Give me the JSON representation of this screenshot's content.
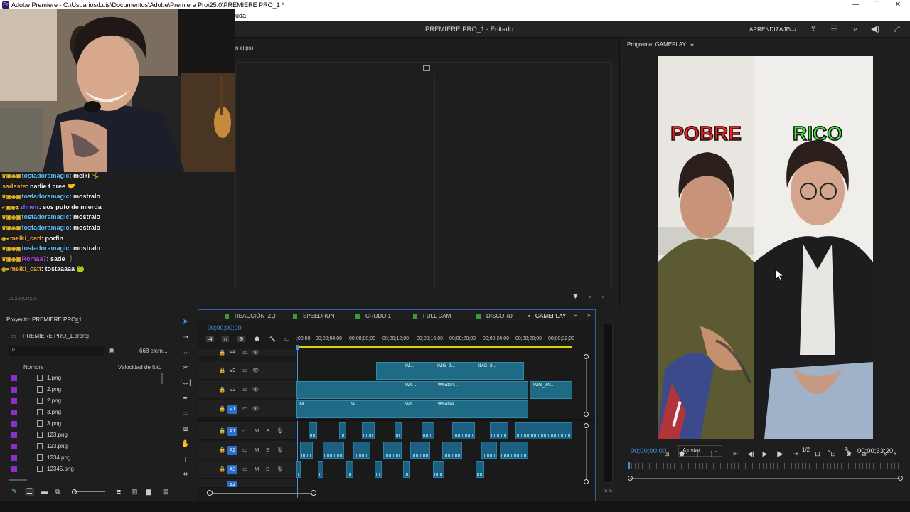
{
  "titlebar": {
    "logo": "Pr",
    "title": "Adobe Premiere - C:\\Usuarios\\Luis\\Documentos\\Adobe\\Premiere Pro\\25.0\\PREMIERE PRO_1 *",
    "minimize": "—",
    "restore": "❐",
    "close": "✕"
  },
  "menubar": {
    "partial_item": "uda"
  },
  "header": {
    "project_title": "PREMIERE PRO_1 - Editado",
    "learn": "APRENDIZAJE"
  },
  "source": {
    "partial_tab": "n clips)",
    "timecode": "00;00;00;00"
  },
  "chat": [
    {
      "badges": "♛▣◉▣",
      "user": "tostadoramagic",
      "user_color": "#5fc0ff",
      "text": "melki 🤸"
    },
    {
      "badges": "",
      "user": "sadeste",
      "user_color": "#e8a33b",
      "text": "nadie t cree 🤝"
    },
    {
      "badges": "♛▣◉▣",
      "user": "tostadoramagic",
      "user_color": "#5fc0ff",
      "text": "mostralo"
    },
    {
      "badges": "✔▣◉⧗",
      "user": "zhheir",
      "user_color": "#8a5cff",
      "text": "sos puto de mierda"
    },
    {
      "badges": "♛▣◉▣",
      "user": "tostadoramagic",
      "user_color": "#5fc0ff",
      "text": "mostralo"
    },
    {
      "badges": "♛▣◉▣",
      "user": "tostadoramagic",
      "user_color": "#5fc0ff",
      "text": "mostralo"
    },
    {
      "badges": "◉♥",
      "user": "melki_catt",
      "user_color": "#e8a33b",
      "text": "porfin"
    },
    {
      "badges": "♛▣◉▣",
      "user": "tostadoramagic",
      "user_color": "#5fc0ff",
      "text": "mostralo"
    },
    {
      "badges": "♛▣◉▣",
      "user": "Romaa7",
      "user_color": "#b44ad8",
      "text": "sade 🕴"
    },
    {
      "badges": "◉♥",
      "user": "melki_catt",
      "user_color": "#e8a33b",
      "text": "tostaaaaa 🐸"
    }
  ],
  "program": {
    "title": "Programa: GAMEPLAY",
    "left_label": "POBRE",
    "left_color": "#ff1e1e",
    "right_label": "RICO",
    "right_color": "#3ee63e",
    "timecode": "00;00;00;00",
    "fit": "Ajustar",
    "resolution": "1/2",
    "duration": "00;00;33;20"
  },
  "project": {
    "title": "Proyecto: PREMIERE PRO_1",
    "file": "PREMIERE PRO_1.prproj",
    "count": "668 elem...",
    "col_name": "Nombre",
    "col_fps": "Velocidad de foto",
    "items": [
      "1.png",
      "2.png",
      "2.png",
      "3.png",
      "3.png",
      "123.png",
      "123.png",
      "1234.png",
      "12345.png"
    ]
  },
  "timeline": {
    "tabs": [
      {
        "label": "REACCIÓN IZQ",
        "color": "#3a9a3a"
      },
      {
        "label": "SPEEDRUN",
        "color": "#3a9a3a"
      },
      {
        "label": "CRUDO 1",
        "color": "#3a9a3a"
      },
      {
        "label": "FULL CAM",
        "color": "#3a9a3a"
      },
      {
        "label": "DISCORD",
        "color": "#3a9a3a"
      },
      {
        "label": "GAMEPLAY",
        "color": ""
      }
    ],
    "timecode": "00;00;00;00",
    "ruler": [
      ";00;00",
      "00;00;04;00",
      "00;00;08;00",
      "00;00;12;00",
      "00;00;16;00",
      "00;00;20;00",
      "00;00;24;00",
      "00;00;28;00",
      "00;00;32;00"
    ],
    "video_tracks": [
      "V4",
      "V3",
      "V2",
      "V1"
    ],
    "audio_tracks": [
      "A1",
      "A2",
      "A3",
      "A4"
    ],
    "clip_labels": [
      "IM...",
      "IMG_2...",
      "IMG_2...",
      "Wh...",
      "WhatsA...",
      "IMG_24...",
      "IM...",
      "W...",
      "Wh...",
      "WhatsA..."
    ],
    "mute": "M",
    "solo": "S",
    "fx": "fx"
  },
  "vu": {
    "label": "S S"
  }
}
